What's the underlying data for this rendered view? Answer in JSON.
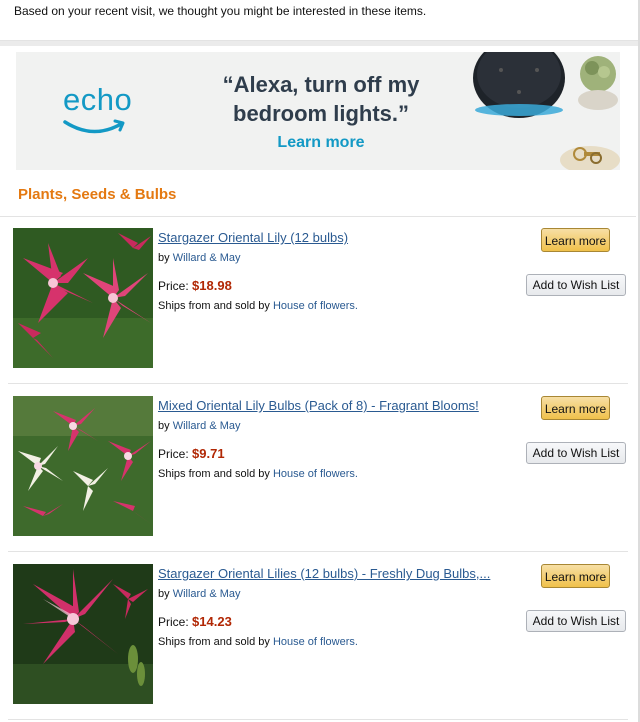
{
  "intro": {
    "text": "Based on your recent visit, we thought you might be interested in these items."
  },
  "banner": {
    "brand": "echo",
    "quote_line1": "“Alexa, turn off my",
    "quote_line2": "bedroom lights.”",
    "cta": "Learn more",
    "colors": {
      "brand_blue": "#1399c5",
      "text_dark": "#2f3d4c",
      "background": "#f1f2f1"
    }
  },
  "section": {
    "title": "Plants, Seeds & Bulbs",
    "title_color": "#e47911"
  },
  "labels": {
    "by": "by",
    "price": "Price:",
    "ships": "Ships from and sold by",
    "learn_more": "Learn more",
    "wish_list": "Add to Wish List"
  },
  "items": [
    {
      "title": "Stargazer Oriental Lily (12 bulbs)",
      "brand": "Willard & May",
      "price": "$18.98",
      "seller": "House of flowers."
    },
    {
      "title": "Mixed Oriental Lily Bulbs (Pack of 8) - Fragrant Blooms!",
      "brand": "Willard & May",
      "price": "$9.71",
      "seller": "House of flowers."
    },
    {
      "title": "Stargazer Oriental Lilies (12 bulbs) - Freshly Dug Bulbs,...",
      "brand": "Willard & May",
      "price": "$14.23",
      "seller": "House of flowers."
    }
  ],
  "colors": {
    "link": "#2a5a91",
    "price": "#b12704",
    "learn_button": "#f0c14b",
    "wish_button": "#e7e9ec"
  }
}
